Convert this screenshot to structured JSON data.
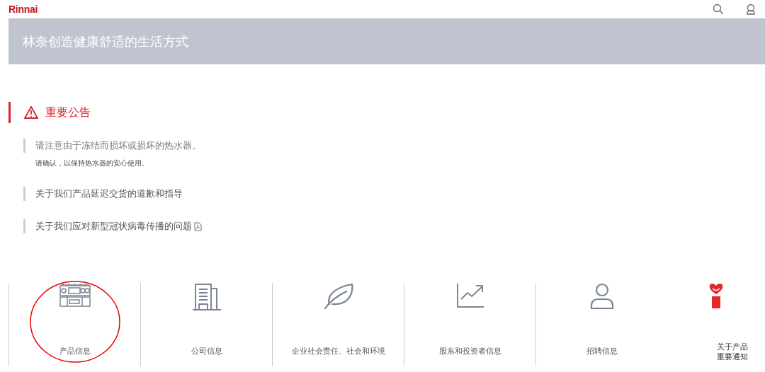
{
  "header": {
    "logo": "Rinnai"
  },
  "banner": {
    "title": "林奈创造健康舒适的生活方式"
  },
  "notices": {
    "heading": "重要公告",
    "items": [
      {
        "kind": "notice",
        "text": "请注意由于冻结而损坏或损坏的热水器。",
        "note": "请确认，以保持热水器的安心使用。"
      },
      {
        "kind": "link",
        "text": "关于我们产品延迟交货的道歉和指导"
      },
      {
        "kind": "pdf",
        "text": "关于我们应对新型冠状病毒传播的问题"
      }
    ]
  },
  "categories": [
    {
      "label": "产品信息",
      "circled": true
    },
    {
      "label": "公司信息",
      "circled": false
    },
    {
      "label": "企业社会责任、社会和环境",
      "circled": false
    },
    {
      "label": "股东和投资者信息",
      "circled": false
    },
    {
      "label": "招聘信息",
      "circled": false
    },
    {
      "label": "关于产品重要通知",
      "circled": false
    }
  ]
}
